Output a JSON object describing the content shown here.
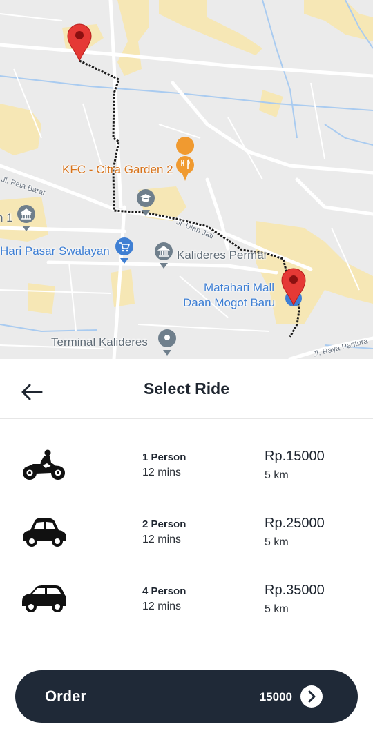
{
  "map": {
    "places": {
      "kfc": "KFC - Citra Garden 2",
      "pasar_swalayan": "Hari Pasar Swalayan",
      "kalideres_permai": "Kalideres Permai",
      "matahari_line1": "Matahari Mall",
      "matahari_line2": "Daan Mogot Baru",
      "terminal": "Terminal Kalideres",
      "edge_label": "n 1"
    },
    "roads": {
      "peta_barat": "Jl. Peta Barat",
      "ulan_jati": "Jl. Ulan Jati",
      "raya_pantura": "Jl. Raya Pantura"
    },
    "colors": {
      "pin": "#e53935",
      "route": "#222222",
      "land": "#ebebeb",
      "block": "#f6e7b5"
    }
  },
  "header": {
    "title": "Select Ride",
    "back_icon": "arrow-left-icon"
  },
  "rides": [
    {
      "vehicle": "motorcycle-icon",
      "persons": "1 Person",
      "eta": "12 mins",
      "price": "Rp.15000",
      "distance": "5 km"
    },
    {
      "vehicle": "car-icon",
      "persons": "2 Person",
      "eta": "12 mins",
      "price": "Rp.25000",
      "distance": "5 km"
    },
    {
      "vehicle": "suv-icon",
      "persons": "4 Person",
      "eta": "12 mins",
      "price": "Rp.35000",
      "distance": "5 km"
    }
  ],
  "order": {
    "label": "Order",
    "amount": "15000",
    "icon": "chevron-right-icon",
    "bar_color": "#1f2937"
  }
}
